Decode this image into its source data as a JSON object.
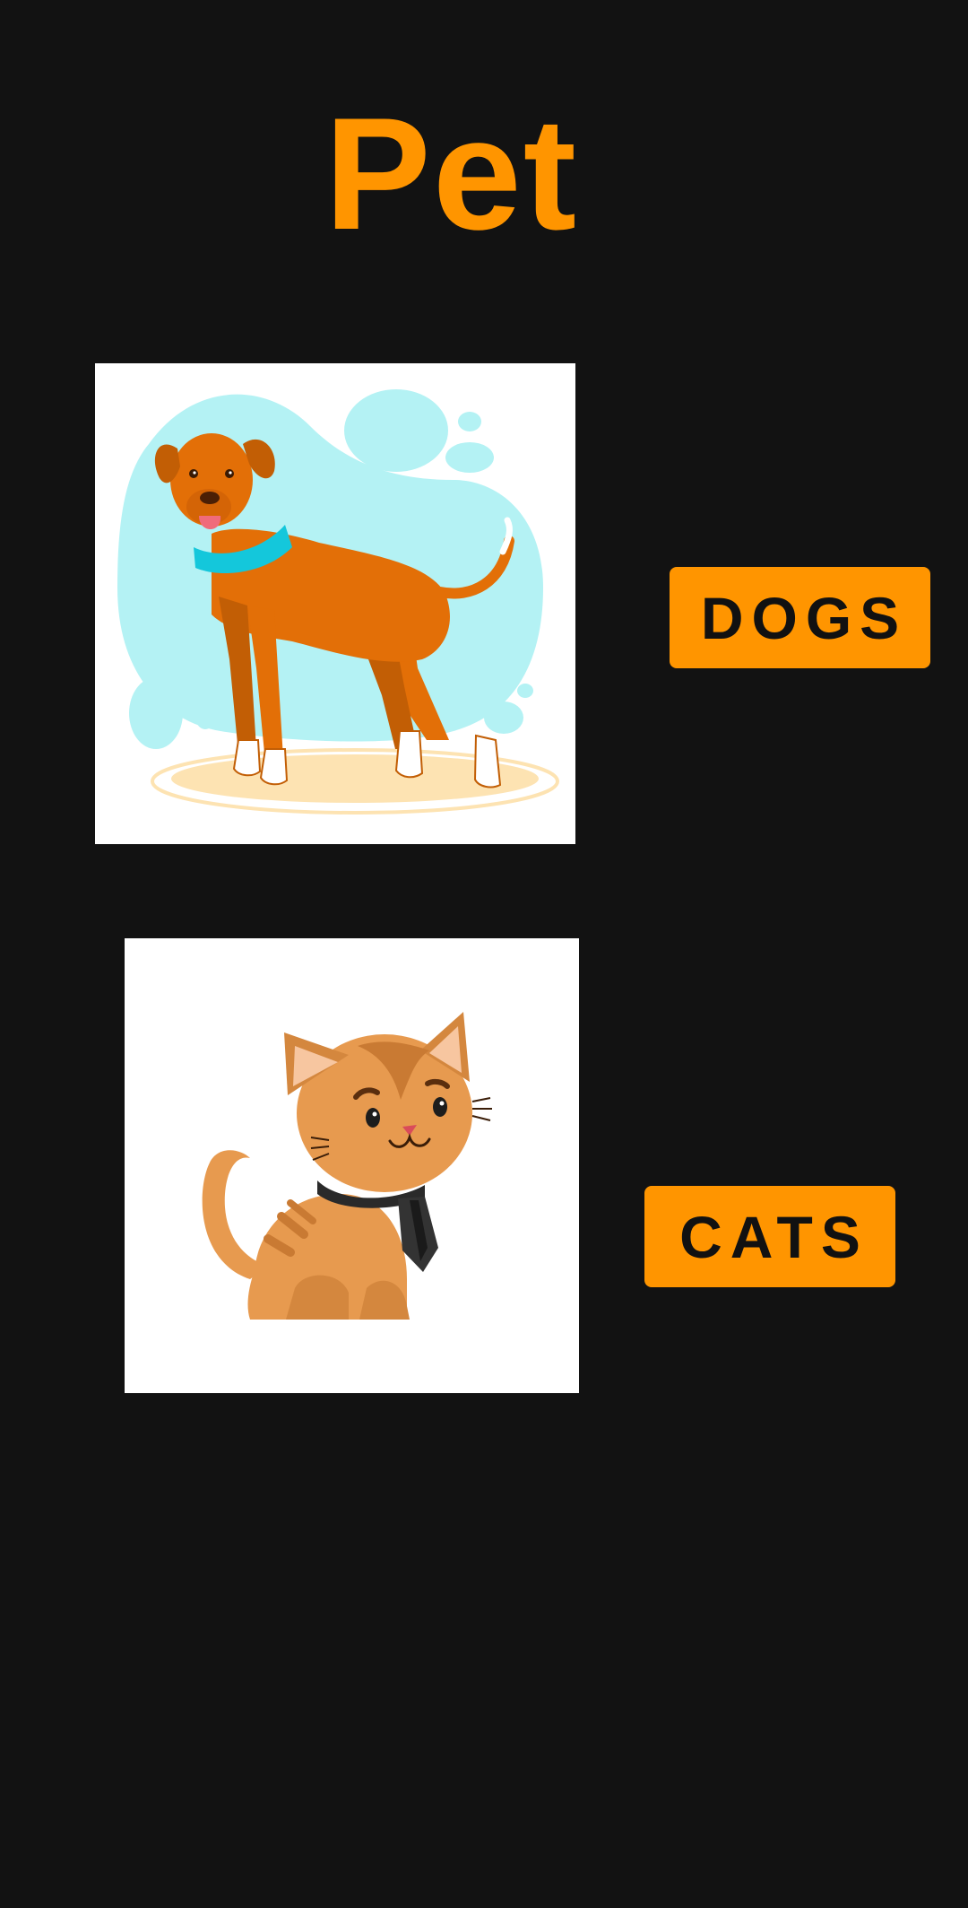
{
  "app": {
    "title": "Pet"
  },
  "pets": [
    {
      "image": "dog-illustration",
      "button_label": "DOGS"
    },
    {
      "image": "cat-illustration",
      "button_label": "CATS"
    }
  ],
  "colors": {
    "background": "#121212",
    "accent": "#FF9500",
    "button_text": "#111111"
  }
}
